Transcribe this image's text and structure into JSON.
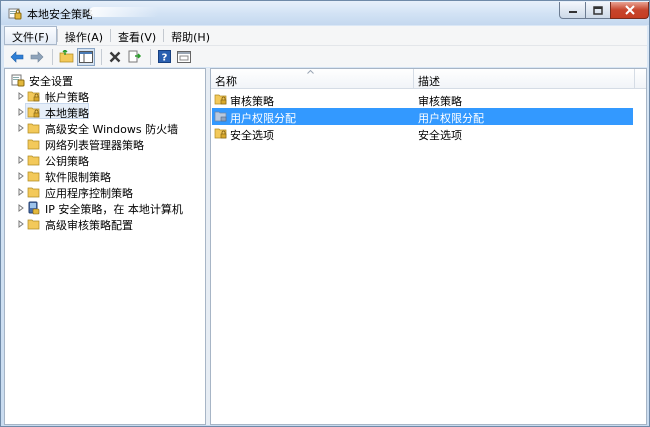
{
  "window": {
    "title": "本地安全策略"
  },
  "menu": [
    {
      "label": "文件(F)"
    },
    {
      "label": "操作(A)"
    },
    {
      "label": "查看(V)"
    },
    {
      "label": "帮助(H)"
    }
  ],
  "toolbar": {
    "buttons": [
      "back-arrow-icon",
      "forward-arrow-icon",
      "up-folder-icon",
      "show-hide-tree-icon",
      "delete-icon",
      "export-list-icon",
      "help-icon",
      "console-icon"
    ]
  },
  "tree": {
    "root": {
      "label": "安全设置"
    },
    "items": [
      {
        "label": "帐户策略"
      },
      {
        "label": "本地策略"
      },
      {
        "label": "高级安全 Windows 防火墙"
      },
      {
        "label": "网络列表管理器策略"
      },
      {
        "label": "公钥策略"
      },
      {
        "label": "软件限制策略"
      },
      {
        "label": "应用程序控制策略"
      },
      {
        "label": "IP 安全策略，在 本地计算机"
      },
      {
        "label": "高级审核策略配置"
      }
    ]
  },
  "list": {
    "columns": [
      {
        "label": "名称"
      },
      {
        "label": "描述"
      }
    ],
    "rows": [
      {
        "name": "审核策略",
        "description": "审核策略"
      },
      {
        "name": "用户权限分配",
        "description": "用户权限分配"
      },
      {
        "name": "安全选项",
        "description": "安全选项"
      }
    ]
  },
  "colors": {
    "selection": "#3399ff",
    "folder": "#f3c95a"
  }
}
